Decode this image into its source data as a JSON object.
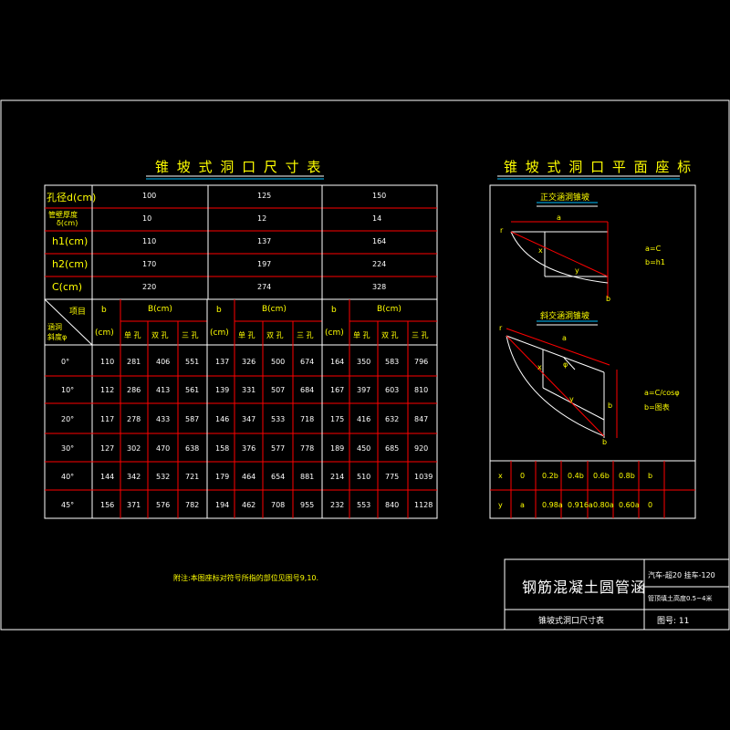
{
  "left_table": {
    "title": "锥 坡 式 洞 口 尺 寸 表",
    "top_rows": [
      {
        "label": "孔径d(cm)",
        "values": [
          "100",
          "125",
          "150"
        ]
      },
      {
        "label_line1": "管壁厚度",
        "label_line2": "δ(cm)",
        "values": [
          "10",
          "12",
          "14"
        ]
      },
      {
        "label": "h1(cm)",
        "values": [
          "110",
          "137",
          "164"
        ]
      },
      {
        "label": "h2(cm)",
        "values": [
          "170",
          "197",
          "224"
        ]
      },
      {
        "label": "C(cm)",
        "values": [
          "220",
          "274",
          "328"
        ]
      }
    ],
    "header": {
      "item": "项目",
      "diag_line1": "涵洞",
      "diag_line2": "斜度φ",
      "b": "b",
      "cm": "(cm)",
      "B": "B(cm)",
      "single": "单 孔",
      "double": "双 孔",
      "triple": "三 孔"
    },
    "rows": [
      {
        "angle": "0°",
        "g1": [
          "110",
          "281",
          "406",
          "551"
        ],
        "g2": [
          "137",
          "326",
          "500",
          "674"
        ],
        "g3": [
          "164",
          "350",
          "583",
          "796"
        ]
      },
      {
        "angle": "10°",
        "g1": [
          "112",
          "286",
          "413",
          "561"
        ],
        "g2": [
          "139",
          "331",
          "507",
          "684"
        ],
        "g3": [
          "167",
          "397",
          "603",
          "810"
        ]
      },
      {
        "angle": "20°",
        "g1": [
          "117",
          "278",
          "433",
          "587"
        ],
        "g2": [
          "146",
          "347",
          "533",
          "718"
        ],
        "g3": [
          "175",
          "416",
          "632",
          "847"
        ]
      },
      {
        "angle": "30°",
        "g1": [
          "127",
          "302",
          "470",
          "638"
        ],
        "g2": [
          "158",
          "376",
          "577",
          "778"
        ],
        "g3": [
          "189",
          "450",
          "685",
          "920"
        ]
      },
      {
        "angle": "40°",
        "g1": [
          "144",
          "342",
          "532",
          "721"
        ],
        "g2": [
          "179",
          "464",
          "654",
          "881"
        ],
        "g3": [
          "214",
          "510",
          "775",
          "1039"
        ]
      },
      {
        "angle": "45°",
        "g1": [
          "156",
          "371",
          "576",
          "782"
        ],
        "g2": [
          "194",
          "462",
          "708",
          "955"
        ],
        "g3": [
          "232",
          "553",
          "840",
          "1128"
        ]
      }
    ]
  },
  "right_panel": {
    "title": "锥 坡 式 洞 口 平 面 座 标",
    "diagram1_title": "正交涵洞锥坡",
    "diagram2_title": "斜交涵洞锥坡",
    "d1_labels": {
      "r": "r",
      "a": "a",
      "x": "x",
      "y": "y",
      "b": "b",
      "eq1": "a=C",
      "eq2": "b=h1"
    },
    "d2_labels": {
      "r": "r",
      "a": "a",
      "x": "x",
      "y": "y",
      "phi": "φ",
      "b": "b",
      "eq1": "a=C/cosφ",
      "eq2": "b=图表"
    },
    "coord_table": {
      "x_row": [
        "x",
        "0",
        "0.2b",
        "0.4b",
        "0.6b",
        "0.8b",
        "b"
      ],
      "y_row": [
        "y",
        "a",
        "0.98a",
        "0.916a",
        "0.80a",
        "0.60a",
        "0"
      ]
    }
  },
  "note": "附注:本图座标对符号所指的部位见图号9,10.",
  "title_block": {
    "main_title": "钢筋混凝土圆管涵",
    "load": "汽车-超20 挂车-120",
    "fill": "管顶填土高度0.5~4米",
    "subtitle": "锥坡式洞口尺寸表",
    "drawing_no": "图号: 11"
  },
  "colors": {
    "line_red": "#ff0000",
    "line_white": "#ffffff",
    "text_yellow": "#ffff00",
    "text_white": "#ffffff",
    "accent_cyan": "#00c0ff"
  }
}
